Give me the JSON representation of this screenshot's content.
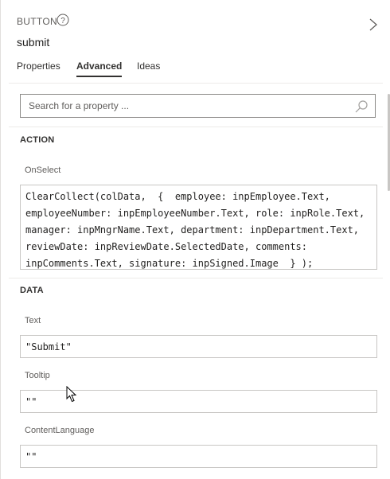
{
  "header": {
    "control_type": "BUTTON",
    "help_glyph": "?",
    "control_name": "submit",
    "collapse_icon": "chevron-right-icon"
  },
  "tabs": [
    {
      "label": "Properties",
      "active": false
    },
    {
      "label": "Advanced",
      "active": true
    },
    {
      "label": "Ideas",
      "active": false
    }
  ],
  "search": {
    "placeholder": "Search for a property ...",
    "icon": "search-icon"
  },
  "sections": {
    "action": {
      "title": "ACTION",
      "onselect_label": "OnSelect",
      "onselect_value": "ClearCollect(colData,  {  employee: inpEmployee.Text,\nemployeeNumber: inpEmployeeNumber.Text, role: inpRole.Text,\nmanager: inpMngrName.Text, department: inpDepartment.Text,\nreviewDate: inpReviewDate.SelectedDate, comments:\ninpComments.Text, signature: inpSigned.Image  } );"
    },
    "data": {
      "title": "DATA",
      "text_label": "Text",
      "text_value": "\"Submit\"",
      "tooltip_label": "Tooltip",
      "tooltip_value": "\"\"",
      "contentlanguage_label": "ContentLanguage",
      "contentlanguage_value": "\"\""
    }
  },
  "colors": {
    "text": "#323130",
    "border": "#8a8886",
    "divider": "#edebe9"
  }
}
